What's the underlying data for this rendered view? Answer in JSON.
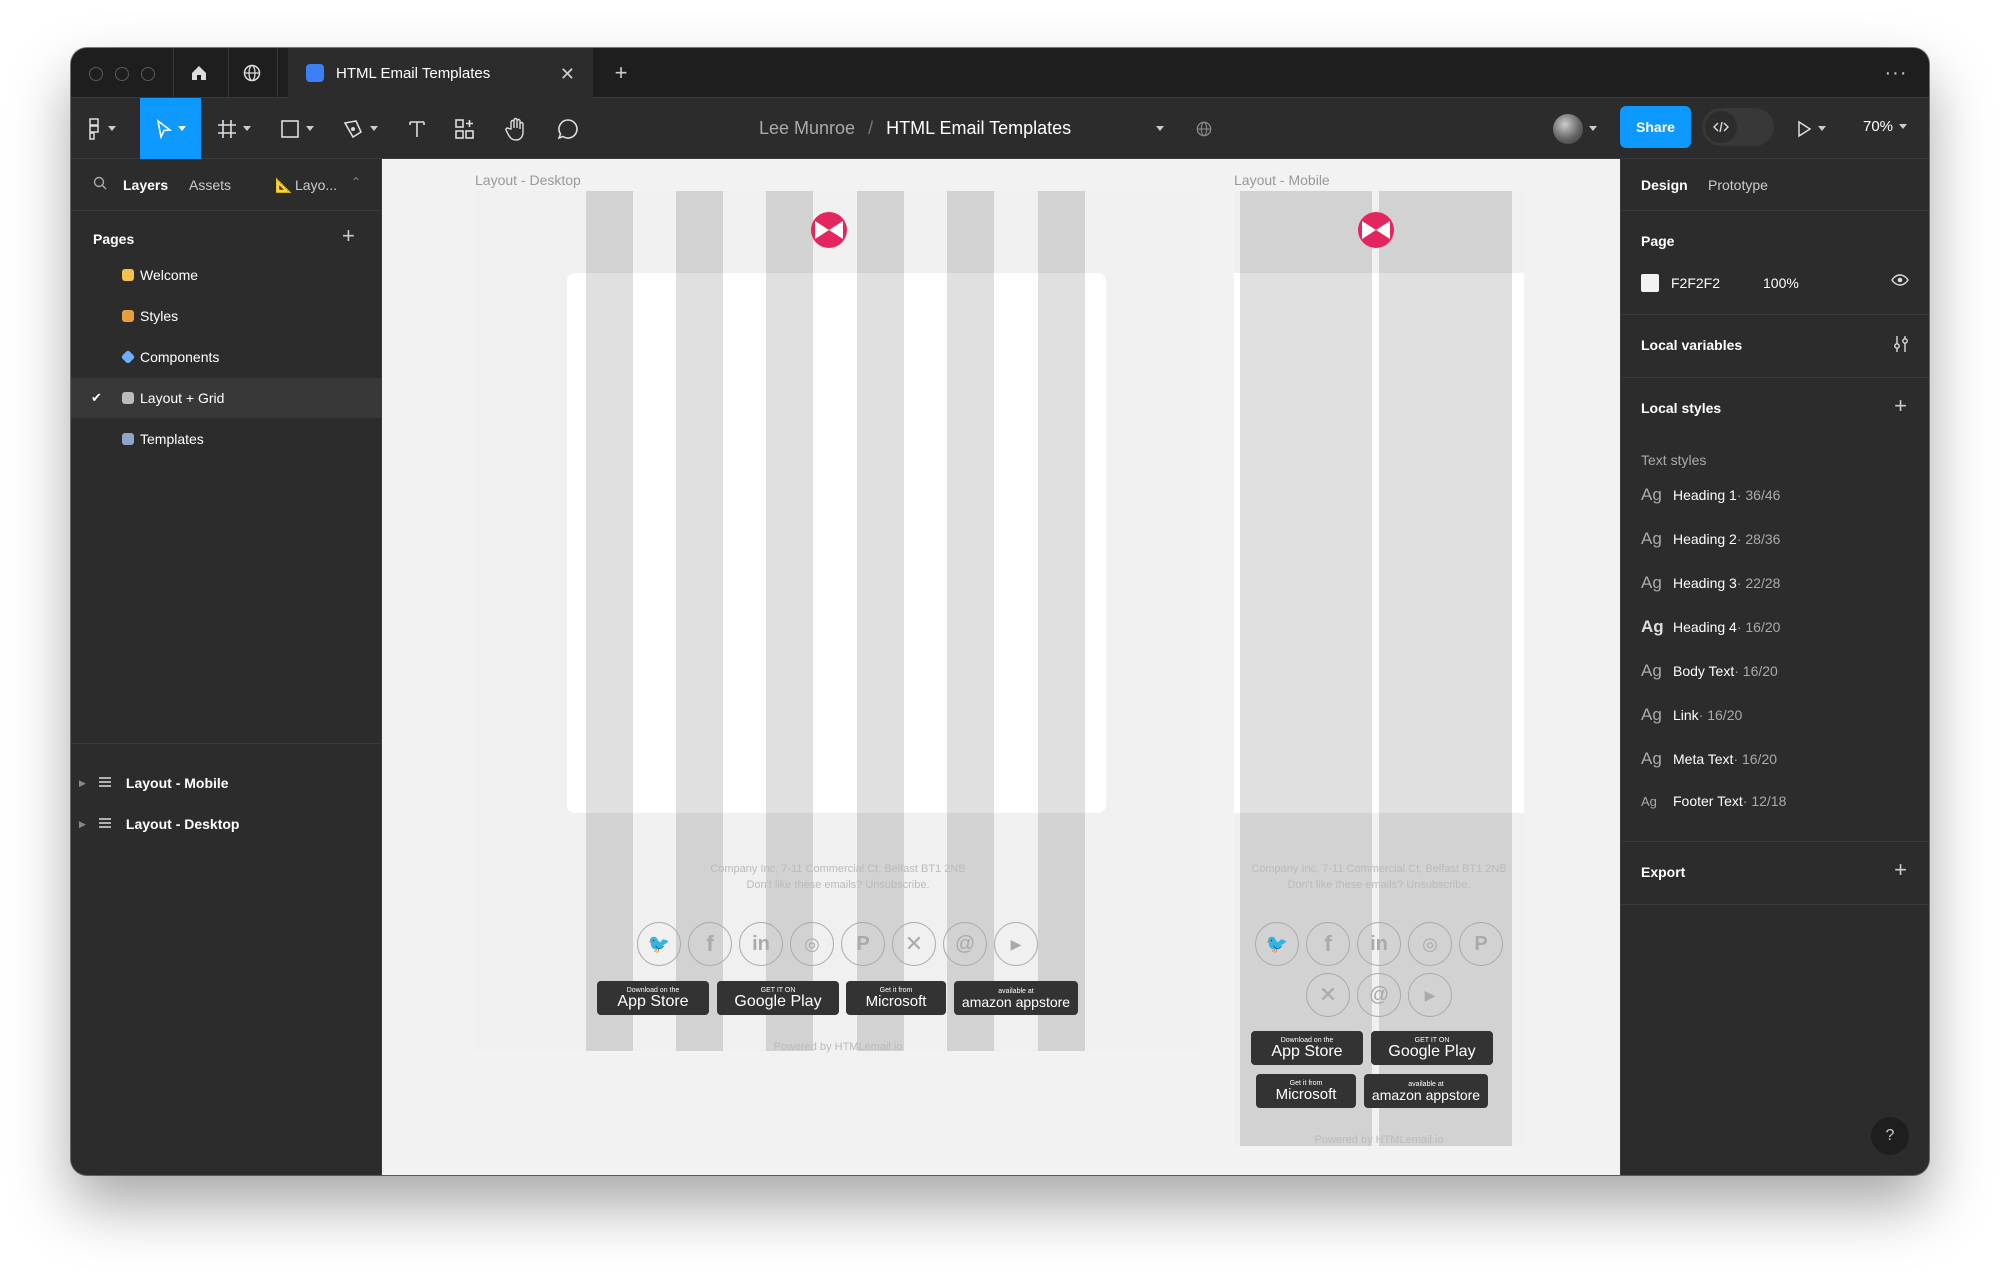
{
  "tab": {
    "title": "HTML Email Templates"
  },
  "breadcrumb": {
    "team": "Lee Munroe",
    "sep": "/",
    "file": "HTML Email Templates"
  },
  "toolbar": {
    "share": "Share",
    "zoom": "70%"
  },
  "left_panel": {
    "tabs": {
      "layers": "Layers",
      "assets": "Assets",
      "page": "Layo..."
    },
    "pages_title": "Pages",
    "pages": [
      {
        "label": "Welcome",
        "emoji_color": "#f5c14d"
      },
      {
        "label": "Styles",
        "emoji_color": "#e89f3d"
      },
      {
        "label": "Components",
        "emoji_color": "#6ab0ff"
      },
      {
        "label": "Layout + Grid",
        "emoji_color": "#bbb"
      },
      {
        "label": "Templates",
        "emoji_color": "#8fa4c8"
      }
    ],
    "layers": [
      {
        "label": "Layout - Mobile"
      },
      {
        "label": "Layout - Desktop"
      }
    ]
  },
  "canvas": {
    "desktop_label": "Layout - Desktop",
    "mobile_label": "Layout - Mobile",
    "footer_line1": "Company Inc, 7-11 Commercial Ct, Belfast BT1 2NB",
    "footer_line2": "Don't like these emails? Unsubscribe.",
    "powered": "Powered by HTMLemail.io",
    "stores": {
      "app_store_small": "Download on the",
      "app_store": "App Store",
      "google_small": "GET IT ON",
      "google": "Google Play",
      "ms_small": "Get it from",
      "ms": "Microsoft",
      "amazon_small": "available at",
      "amazon": "amazon appstore"
    }
  },
  "right_panel": {
    "tabs": {
      "design": "Design",
      "prototype": "Prototype"
    },
    "page_title": "Page",
    "page_color": "F2F2F2",
    "page_opacity": "100%",
    "local_variables": "Local variables",
    "local_styles": "Local styles",
    "text_styles_title": "Text styles",
    "text_styles": [
      {
        "ag": "Ag",
        "name": "Heading 1",
        "meta": " · 36/46"
      },
      {
        "ag": "Ag",
        "name": "Heading 2",
        "meta": " · 28/36"
      },
      {
        "ag": "Ag",
        "name": "Heading 3",
        "meta": " · 22/28"
      },
      {
        "ag": "Ag",
        "name": "Heading 4",
        "meta": " · 16/20"
      },
      {
        "ag": "Ag",
        "name": "Body Text",
        "meta": " · 16/20"
      },
      {
        "ag": "Ag",
        "name": "Link",
        "meta": " · 16/20"
      },
      {
        "ag": "Ag",
        "name": "Meta Text",
        "meta": " · 16/20"
      },
      {
        "ag": "Ag",
        "name": "Footer Text",
        "meta": " · 12/18"
      }
    ],
    "export": "Export",
    "help": "?"
  }
}
